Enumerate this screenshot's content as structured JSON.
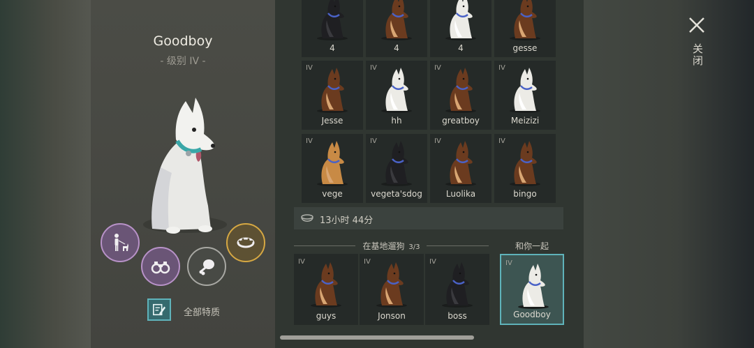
{
  "dog": {
    "name": "Goodboy",
    "level": "- 级别 IV -",
    "collar_color": "#3aa7a8"
  },
  "skills": [
    {
      "icon": "person-with-dog-icon",
      "state": "unlocked"
    },
    {
      "icon": "binoculars-icon",
      "state": "unlocked"
    },
    {
      "icon": "meat-icon",
      "state": "available"
    },
    {
      "icon": "spiked-collar-icon",
      "state": "unlocked"
    }
  ],
  "traits": {
    "label": "全部特质",
    "icon": "notes-icon"
  },
  "grid_rows": [
    [
      {
        "level": "",
        "name": "4",
        "coat": "black"
      },
      {
        "level": "",
        "name": "4",
        "coat": "brown"
      },
      {
        "level": "",
        "name": "4",
        "coat": "white"
      },
      {
        "level": "",
        "name": "gesse",
        "coat": "brown"
      }
    ],
    [
      {
        "level": "IV",
        "name": "Jesse",
        "coat": "brown"
      },
      {
        "level": "IV",
        "name": "hh",
        "coat": "white"
      },
      {
        "level": "IV",
        "name": "greatboy",
        "coat": "brown"
      },
      {
        "level": "IV",
        "name": "Meizizi",
        "coat": "white"
      }
    ],
    [
      {
        "level": "IV",
        "name": "vege",
        "coat": "tan"
      },
      {
        "level": "IV",
        "name": "vegeta'sdog",
        "coat": "black"
      },
      {
        "level": "IV",
        "name": "Luolika",
        "coat": "brown"
      },
      {
        "level": "IV",
        "name": "bingo",
        "coat": "brown"
      }
    ]
  ],
  "timer": {
    "text": "13小时 44分",
    "icon": "food-bowl-icon"
  },
  "walk": {
    "title": "在基地遛狗",
    "count": "3/3",
    "dogs": [
      {
        "level": "IV",
        "name": "guys",
        "coat": "brown"
      },
      {
        "level": "IV",
        "name": "Jonson",
        "coat": "brown"
      },
      {
        "level": "IV",
        "name": "boss",
        "coat": "black"
      }
    ]
  },
  "with_you": {
    "title": "和你一起",
    "dog": {
      "level": "IV",
      "name": "Goodboy",
      "coat": "white"
    }
  },
  "close": {
    "label": "关闭",
    "icon": "close-icon"
  },
  "coat_colors": {
    "brown": "#6b3b1f",
    "white": "#ecebe6",
    "black": "#1f1f22",
    "tan": "#c88a45"
  }
}
